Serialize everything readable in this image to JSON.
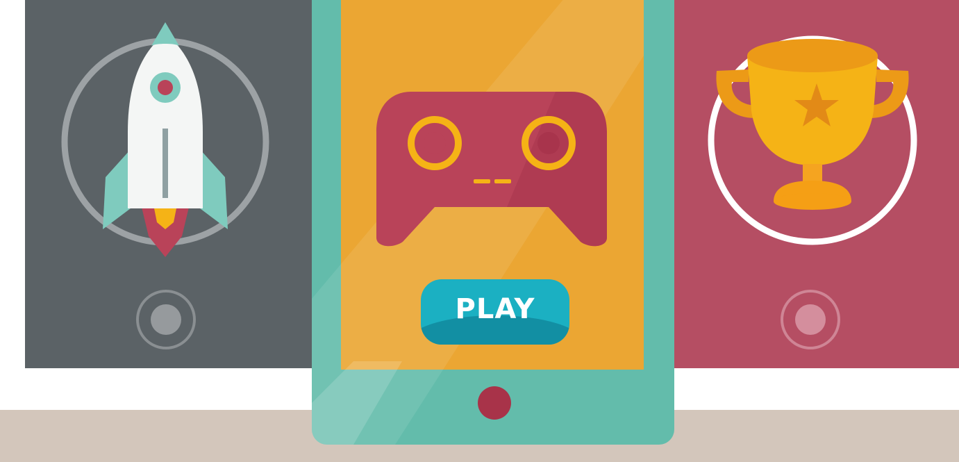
{
  "scene": {
    "play_button": {
      "label": "PLAY"
    },
    "icons": {
      "left": "rocket-icon",
      "center": "gamepad-icon",
      "right": "trophy-icon"
    },
    "colors": {
      "left_device": "#5b6266",
      "center_screen": "#eba633",
      "center_frame": "#63bcab",
      "right_device": "#b54e63",
      "play_button": "#1bb0c2",
      "floor": "#d3c6bb"
    }
  }
}
